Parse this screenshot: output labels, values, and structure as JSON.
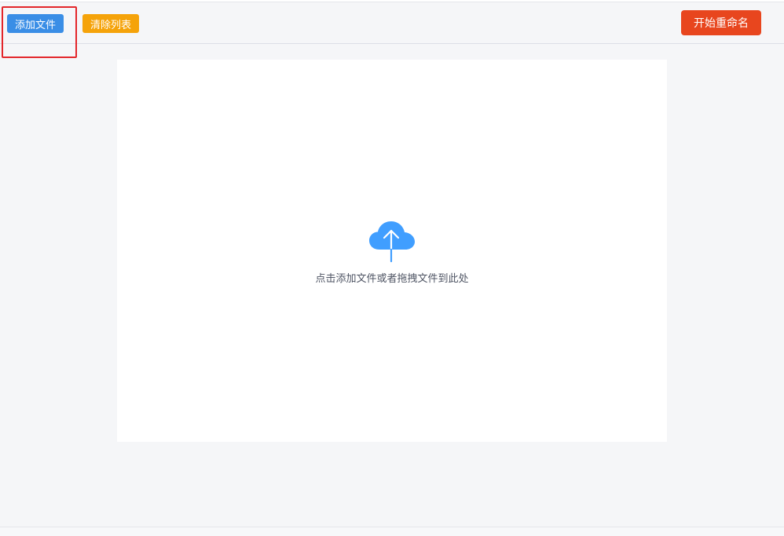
{
  "toolbar": {
    "add_file_label": "添加文件",
    "clear_list_label": "清除列表",
    "start_rename_label": "开始重命名"
  },
  "drop_zone": {
    "hint": "点击添加文件或者拖拽文件到此处",
    "icon": "cloud-upload-icon"
  },
  "colors": {
    "add_button": "#3a8ee6",
    "clear_button": "#f5a30a",
    "start_button": "#e8461e",
    "highlight_box": "#e3262a",
    "icon": "#409eff"
  }
}
